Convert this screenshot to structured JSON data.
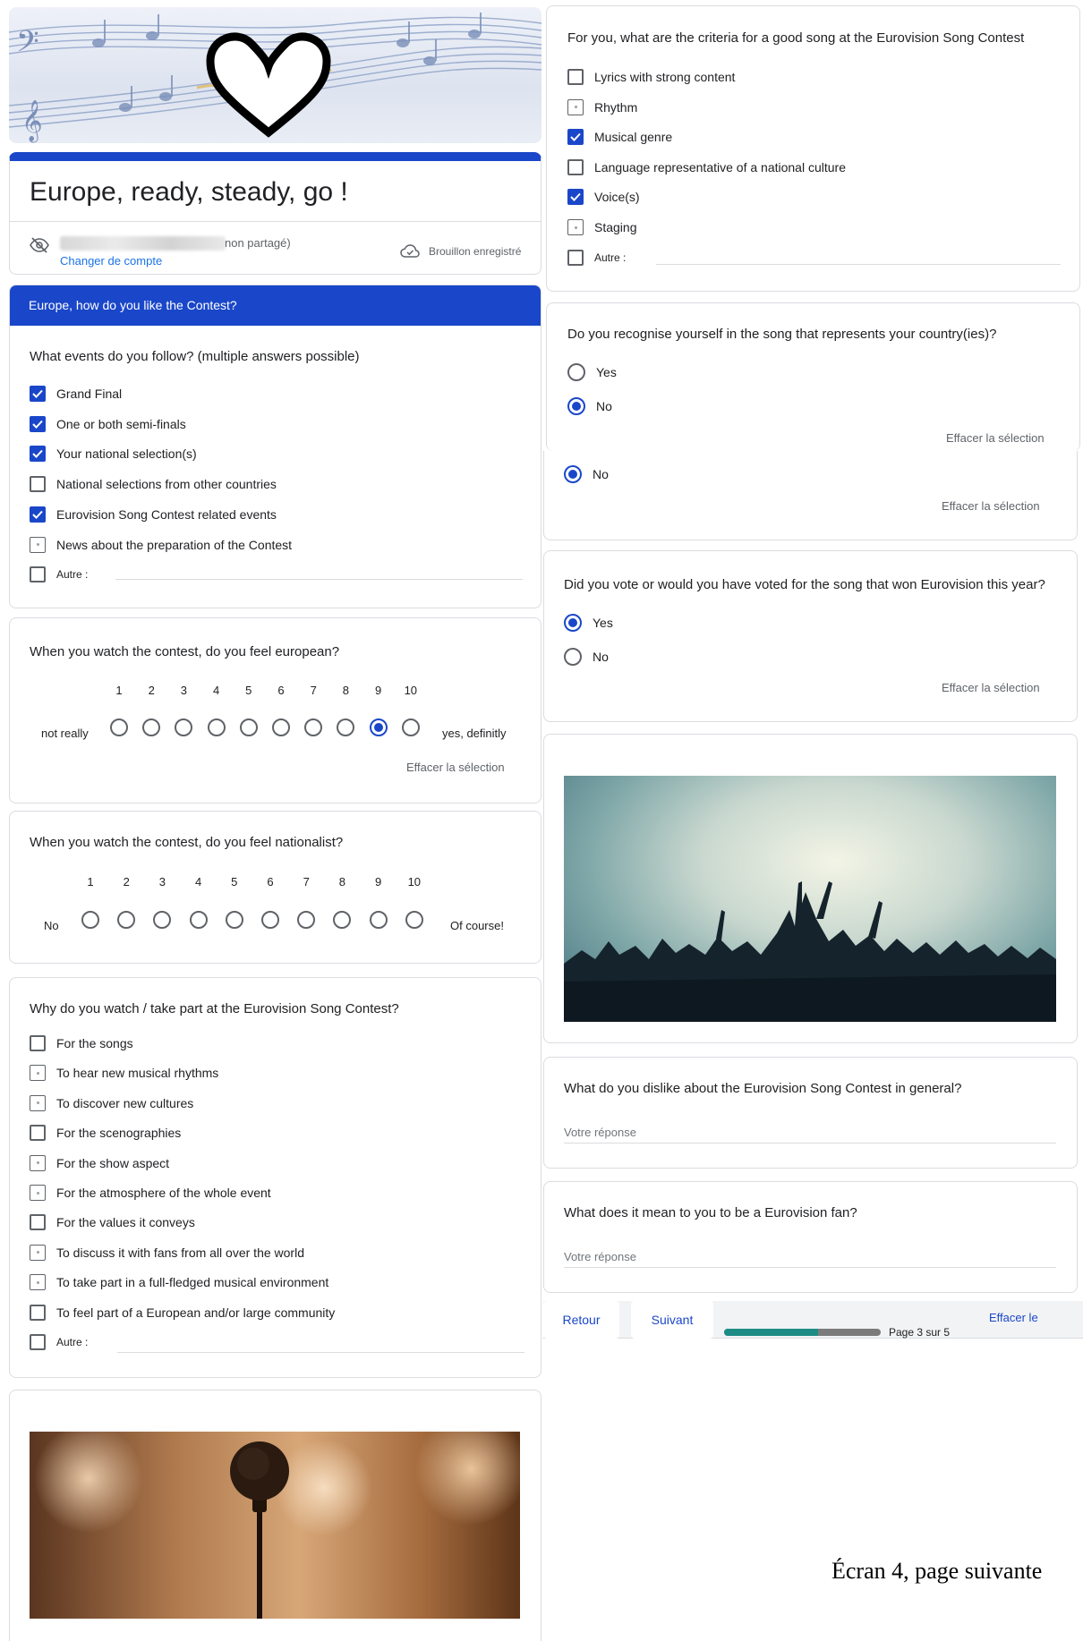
{
  "header": {
    "form_title": "Europe, ready, steady, go !",
    "account_suffix": "non partagé)",
    "change_account": "Changer de compte",
    "draft_status": "Brouillon enregistré"
  },
  "section": {
    "title": "Europe, how do you like the Contest?"
  },
  "q_events": {
    "title": "What events do you follow? (multiple answers possible)",
    "options": [
      {
        "label": "Grand Final",
        "checked": true
      },
      {
        "label": "One or both semi-finals",
        "checked": true
      },
      {
        "label": "Your national selection(s)",
        "checked": true
      },
      {
        "label": "National selections from other countries",
        "checked": false
      },
      {
        "label": "Eurovision Song Contest related events",
        "checked": true
      },
      {
        "label": "News about the preparation of the Contest",
        "checked": false
      },
      {
        "label": "Autre :",
        "checked": false
      }
    ]
  },
  "q_european": {
    "title": "When you watch the contest, do you feel european?",
    "numbers": [
      "1",
      "2",
      "3",
      "4",
      "5",
      "6",
      "7",
      "8",
      "9",
      "10"
    ],
    "selected": 9,
    "low_label": "not really",
    "high_label": "yes, definitly",
    "clear": "Effacer la sélection"
  },
  "q_nationalist": {
    "title": "When you watch the contest, do you feel nationalist?",
    "numbers": [
      "1",
      "2",
      "3",
      "4",
      "5",
      "6",
      "7",
      "8",
      "9",
      "10"
    ],
    "selected": 0,
    "low_label": "No",
    "high_label": "Of course!"
  },
  "q_why": {
    "title": "Why do you watch / take part at the Eurovision Song Contest?",
    "options": [
      {
        "label": "For the songs",
        "checked": false
      },
      {
        "label": "To hear new musical rhythms",
        "checked": false
      },
      {
        "label": "To discover new cultures",
        "checked": false
      },
      {
        "label": "For the scenographies",
        "checked": false
      },
      {
        "label": "For the show aspect",
        "checked": false
      },
      {
        "label": "For the atmosphere of the whole event",
        "checked": false
      },
      {
        "label": "For the values it conveys",
        "checked": false
      },
      {
        "label": "To discuss it with fans from all over the world",
        "checked": false
      },
      {
        "label": "To take part in a full-fledged musical environment",
        "checked": false
      },
      {
        "label": "To feel part of a European and/or large community",
        "checked": false
      },
      {
        "label": "Autre :",
        "checked": false
      }
    ]
  },
  "q_criteria": {
    "title": "For you, what are the criteria for a good song at the Eurovision Song Contest",
    "options": [
      {
        "label": "Lyrics with strong content",
        "checked": false
      },
      {
        "label": "Rhythm",
        "checked": false
      },
      {
        "label": "Musical genre",
        "checked": true
      },
      {
        "label": "Language representative of a national culture",
        "checked": false
      },
      {
        "label": "Voice(s)",
        "checked": true
      },
      {
        "label": "Staging",
        "checked": false
      },
      {
        "label": "Autre :",
        "checked": false
      }
    ]
  },
  "q_recognise": {
    "title": "Do you recognise yourself in the song that represents your country(ies)?",
    "options": [
      {
        "label": "Yes",
        "checked": false
      },
      {
        "label": "No",
        "checked": true
      }
    ],
    "clear": "Effacer la sélection",
    "dup_option": "No",
    "dup_clear": "Effacer la sélection"
  },
  "q_vote": {
    "title": "Did you vote or would you have voted for the song that won Eurovision this year?",
    "options": [
      {
        "label": "Yes",
        "checked": true
      },
      {
        "label": "No",
        "checked": false
      }
    ],
    "clear": "Effacer la sélection"
  },
  "q_dislike": {
    "title": "What do you dislike about the Eurovision Song Contest in general?",
    "placeholder": "Votre réponse"
  },
  "q_fan": {
    "title": "What does it mean to you to be a Eurovision fan?",
    "placeholder": "Votre réponse"
  },
  "footer": {
    "back": "Retour",
    "next": "Suivant",
    "page_indicator": "Page 3 sur 5",
    "progress": 0.6,
    "clear_form": "Effacer le"
  },
  "caption": "Écran 4, page suivante",
  "colors": {
    "accent": "#1a47c9",
    "progress_fill": "#1e8c86",
    "progress_track": "#7b7b7b"
  }
}
